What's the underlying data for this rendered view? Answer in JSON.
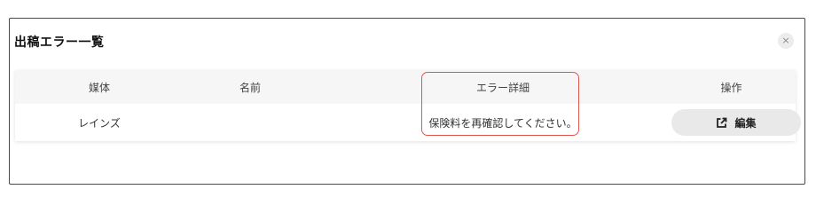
{
  "dialog": {
    "title": "出稿エラー一覧",
    "close_icon": "×"
  },
  "table": {
    "headers": [
      "媒体",
      "名前",
      "エラー詳細",
      "操作"
    ],
    "rows": [
      {
        "media": "レインズ",
        "name": "",
        "error_detail": "保険料を再確認してください。",
        "action_label": "編集",
        "action_icon": "external-link-icon"
      }
    ]
  },
  "colors": {
    "highlight_border": "#e2564a",
    "header_bg": "#f6f6f6",
    "button_bg": "#e9e9e9"
  }
}
